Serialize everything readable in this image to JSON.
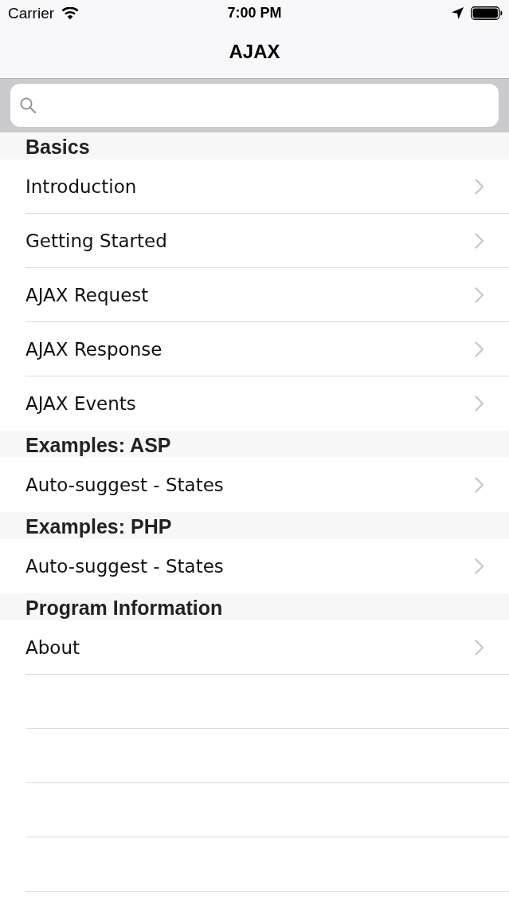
{
  "status_bar": {
    "carrier": "Carrier",
    "time": "7:00 PM"
  },
  "nav_bar": {
    "title": "AJAX"
  },
  "sections": [
    {
      "title": "Basics",
      "items": [
        "Introduction",
        "Getting Started",
        "AJAX Request",
        "AJAX Response",
        "AJAX Events"
      ]
    },
    {
      "title": "Examples: ASP",
      "items": [
        "Auto-suggest - States"
      ]
    },
    {
      "title": "Examples: PHP",
      "items": [
        "Auto-suggest - States"
      ]
    },
    {
      "title": "Program Information",
      "items": [
        "About"
      ]
    }
  ]
}
